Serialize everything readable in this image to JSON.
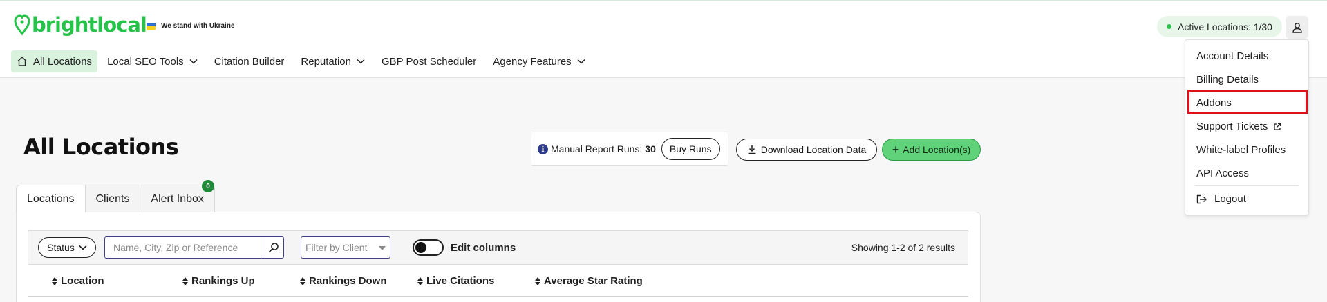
{
  "brand": {
    "name": "brightlocal",
    "color": "#27c24a"
  },
  "banner": {
    "ukraine_text": "We stand with Ukraine"
  },
  "header": {
    "active_locations": "Active Locations: 1/30"
  },
  "nav": {
    "items": [
      {
        "label": "All Locations",
        "active": true,
        "icon": "home-icon"
      },
      {
        "label": "Local SEO Tools",
        "dropdown": true
      },
      {
        "label": "Citation Builder"
      },
      {
        "label": "Reputation",
        "dropdown": true
      },
      {
        "label": "GBP Post Scheduler"
      },
      {
        "label": "Agency Features",
        "dropdown": true
      }
    ]
  },
  "page": {
    "title": "All Locations"
  },
  "runs": {
    "label": "Manual Report Runs:",
    "count": "30",
    "buy_label": "Buy Runs"
  },
  "actions": {
    "download_label": "Download Location Data",
    "add_label": "Add Location(s)"
  },
  "tabs": [
    {
      "label": "Locations",
      "active": true
    },
    {
      "label": "Clients"
    },
    {
      "label": "Alert Inbox",
      "badge": "0"
    }
  ],
  "filters": {
    "status_label": "Status",
    "search_placeholder": "Name, City, Zip or Reference",
    "client_placeholder": "Filter by Client",
    "edit_columns_label": "Edit columns",
    "showing_text": "Showing 1-2 of 2 results"
  },
  "table": {
    "columns": [
      "Location",
      "Rankings Up",
      "Rankings Down",
      "Live Citations",
      "Average Star Rating"
    ]
  },
  "user_menu": {
    "items": [
      "Account Details",
      "Billing Details",
      "Addons",
      "Support Tickets",
      "White-label Profiles",
      "API Access"
    ],
    "logout_label": "Logout",
    "highlighted": "Addons"
  },
  "colors": {
    "accent_green": "#5fd27a",
    "highlight_red": "#e0101a",
    "badge_green": "#1f8a3a"
  }
}
